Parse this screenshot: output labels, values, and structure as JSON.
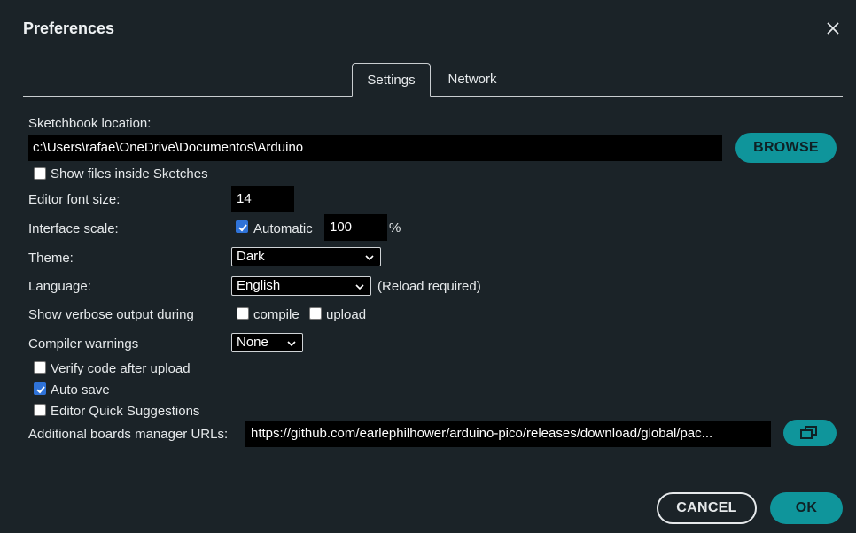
{
  "dialog": {
    "title": "Preferences"
  },
  "tabs": [
    {
      "label": "Settings",
      "active": true
    },
    {
      "label": "Network",
      "active": false
    }
  ],
  "sketchbook": {
    "label": "Sketchbook location:",
    "path": "c:\\Users\\rafae\\OneDrive\\Documentos\\Arduino",
    "browse_label": "BROWSE",
    "show_files_label": "Show files inside Sketches",
    "show_files_checked": false
  },
  "editor_font_size": {
    "label": "Editor font size:",
    "value": "14"
  },
  "interface_scale": {
    "label": "Interface scale:",
    "automatic_label": "Automatic",
    "automatic_checked": true,
    "value": "100",
    "unit": "%"
  },
  "theme": {
    "label": "Theme:",
    "value": "Dark"
  },
  "language": {
    "label": "Language:",
    "value": "English",
    "note": "(Reload required)"
  },
  "verbose": {
    "label": "Show verbose output during",
    "compile_label": "compile",
    "compile_checked": false,
    "upload_label": "upload",
    "upload_checked": false
  },
  "compiler_warnings": {
    "label": "Compiler warnings",
    "value": "None"
  },
  "options": {
    "verify_label": "Verify code after upload",
    "verify_checked": false,
    "autosave_label": "Auto save",
    "autosave_checked": true,
    "quick_suggestions_label": "Editor Quick Suggestions",
    "quick_suggestions_checked": false
  },
  "boards_urls": {
    "label": "Additional boards manager URLs:",
    "value": "https://github.com/earlephilhower/arduino-pico/releases/download/global/pac..."
  },
  "footer": {
    "cancel_label": "CANCEL",
    "ok_label": "OK"
  },
  "colors": {
    "background": "#1b2328",
    "accent": "#0f959b",
    "checkbox_on": "#2f73d9"
  },
  "icons": {
    "close": "close-icon",
    "open_window": "open-window-icon",
    "checkmark": "checkmark-icon",
    "chevron": "chevron-down-icon"
  }
}
